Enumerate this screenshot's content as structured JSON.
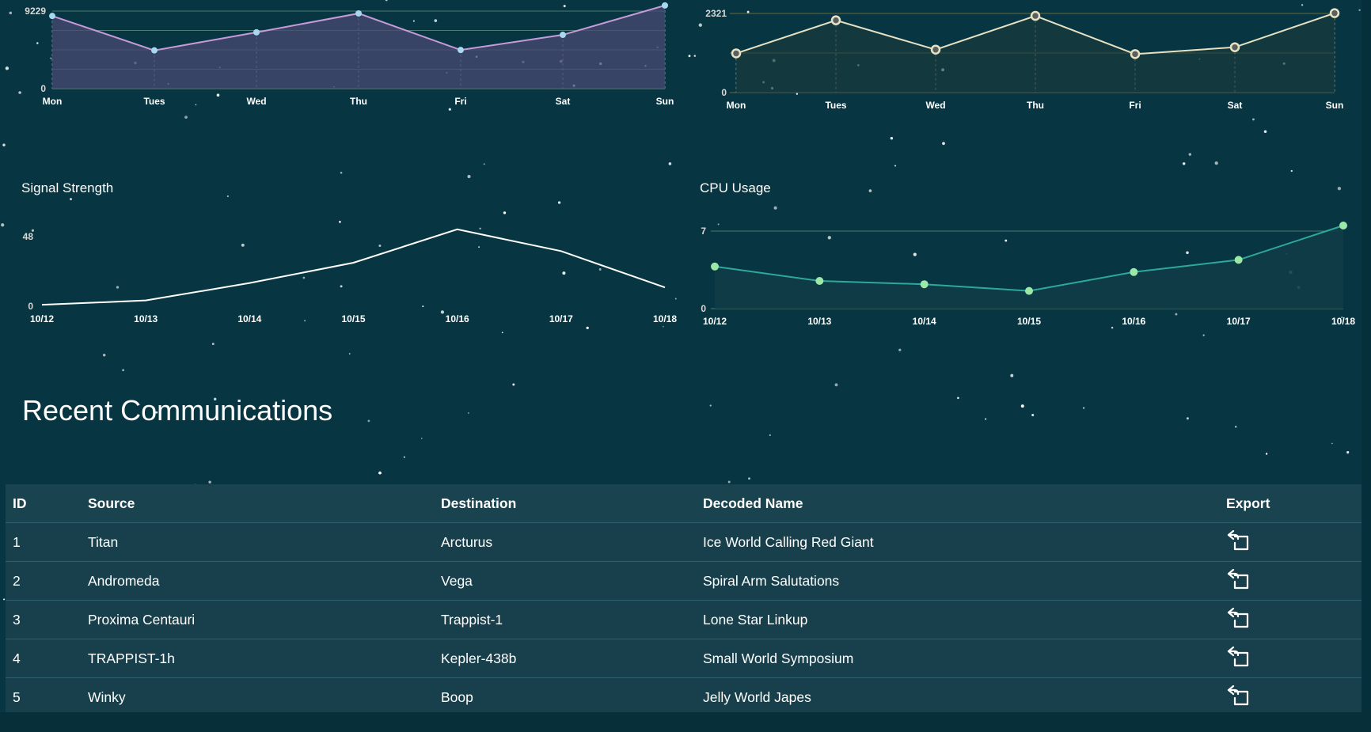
{
  "colors": {
    "background": "#073642",
    "panel_grid": "#4d7a72",
    "purple_line": "#c79ad8",
    "purple_fill": "#4a4a73",
    "purple_point": "#a8d8f0",
    "cream_line": "#e8e2c4",
    "cream_point_fill": "#5a6060",
    "cream_grid": "#6d6a3a",
    "white_line": "#ffffff",
    "teal_line": "#2ea89a",
    "teal_point": "#9be8a8",
    "teal_fill": "#0f3c46"
  },
  "charts": {
    "chart1": {
      "chart_data": {
        "type": "area",
        "categories": [
          "Mon",
          "Tues",
          "Wed",
          "Thu",
          "Fri",
          "Sat",
          "Sun"
        ],
        "values": [
          8650,
          4550,
          6700,
          8950,
          4600,
          6400,
          9900
        ],
        "ylim": [
          0,
          9229
        ],
        "y_tick_labels": [
          "0",
          "9229"
        ],
        "grid": true
      }
    },
    "chart2": {
      "chart_data": {
        "type": "line",
        "categories": [
          "Mon",
          "Tues",
          "Wed",
          "Thu",
          "Fri",
          "Sat",
          "Sun"
        ],
        "values": [
          1150,
          2120,
          1260,
          2250,
          1130,
          1330,
          2330
        ],
        "ylim": [
          0,
          2321
        ],
        "y_tick_labels": [
          "0",
          "2321"
        ],
        "grid": true
      }
    },
    "chart3": {
      "chart_data": {
        "type": "line",
        "title": "Signal Strength",
        "categories": [
          "10/12",
          "10/13",
          "10/14",
          "10/15",
          "10/16",
          "10/17",
          "10/18"
        ],
        "values": [
          1,
          4,
          16,
          30,
          53,
          38,
          13
        ],
        "ylim": [
          0,
          48
        ],
        "y_tick_labels": [
          "0",
          "48"
        ],
        "grid": false
      }
    },
    "chart4": {
      "chart_data": {
        "type": "area",
        "title": "CPU Usage",
        "categories": [
          "10/12",
          "10/13",
          "10/14",
          "10/15",
          "10/16",
          "10/17",
          "10/18"
        ],
        "values": [
          3.8,
          2.5,
          2.2,
          1.6,
          3.3,
          4.4,
          7.5
        ],
        "ylim": [
          0,
          7
        ],
        "y_tick_labels": [
          "0",
          "7"
        ],
        "grid": true
      }
    }
  },
  "communications": {
    "title": "Recent Communications",
    "columns": {
      "id": "ID",
      "source": "Source",
      "destination": "Destination",
      "decoded_name": "Decoded Name",
      "export": "Export"
    },
    "rows": [
      {
        "id": "1",
        "source": "Titan",
        "destination": "Arcturus",
        "decoded_name": "Ice World Calling Red Giant",
        "export_icon": "export-icon"
      },
      {
        "id": "2",
        "source": "Andromeda",
        "destination": "Vega",
        "decoded_name": "Spiral Arm Salutations",
        "export_icon": "export-icon"
      },
      {
        "id": "3",
        "source": "Proxima Centauri",
        "destination": "Trappist-1",
        "decoded_name": "Lone Star Linkup",
        "export_icon": "export-icon"
      },
      {
        "id": "4",
        "source": "TRAPPIST-1h",
        "destination": "Kepler-438b",
        "decoded_name": "Small World Symposium",
        "export_icon": "export-icon"
      },
      {
        "id": "5",
        "source": "Winky",
        "destination": "Boop",
        "decoded_name": "Jelly World Japes",
        "export_icon": "export-icon"
      }
    ]
  }
}
